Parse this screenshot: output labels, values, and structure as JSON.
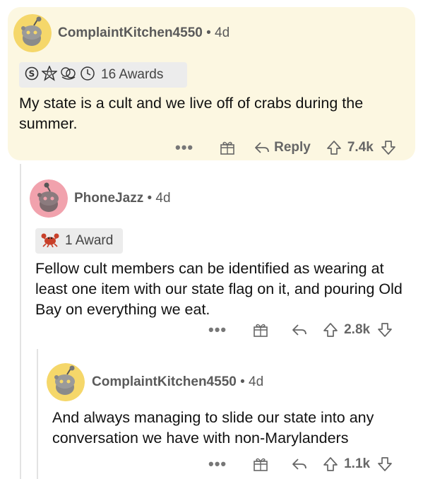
{
  "comments": [
    {
      "username": "ComplaintKitchen4550",
      "time": "4d",
      "awards_text": "16 Awards",
      "body": "My state is a cult and we live off of crabs during the summer.",
      "reply_label": "Reply",
      "score": "7.4k",
      "avatar_color": "#f5d76a"
    },
    {
      "username": "PhoneJazz",
      "time": "4d",
      "awards_text": "1 Award",
      "body": "Fellow cult members can be identified as wearing at least one item with our state flag on it, and pouring Old Bay on everything we eat.",
      "score": "2.8k",
      "avatar_color": "#f1a2ad"
    },
    {
      "username": "ComplaintKitchen4550",
      "time": "4d",
      "body": "And always managing to slide our state into any conversation we have with non-Marylanders",
      "score": "1.1k",
      "avatar_color": "#f5d76a"
    }
  ],
  "separator": "•",
  "more_label": "•••",
  "colors": {
    "highlight_bg": "#fcf7e1",
    "award_box_bg": "#ececec",
    "meta_text": "#5a5a5a"
  }
}
